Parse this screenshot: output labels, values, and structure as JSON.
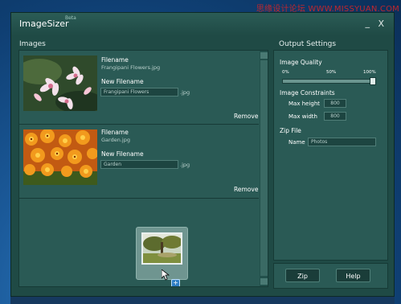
{
  "watermark": "思缘设计论坛 WWW.MISSYUAN.COM",
  "window": {
    "title": "ImageSizer",
    "beta": "Beta",
    "minimize": "_",
    "close": "X"
  },
  "images_panel": {
    "label": "Images",
    "items": [
      {
        "filename_label": "Filename",
        "filename": "Frangipani Flowers.jpg",
        "new_label": "New Filename",
        "new_value": "Frangipani Flowers",
        "ext": ".jpg",
        "remove": "Remove"
      },
      {
        "filename_label": "Filename",
        "filename": "Garden.jpg",
        "new_label": "New Filename",
        "new_value": "Garden",
        "ext": ".jpg",
        "remove": "Remove"
      }
    ],
    "drag_badge": "+"
  },
  "output": {
    "label": "Output Settings",
    "quality": {
      "label": "Image Quality",
      "ticks": [
        "0%",
        "50%",
        "100%"
      ],
      "value_percent": 100
    },
    "constraints": {
      "label": "Image Constraints",
      "max_height_label": "Max height",
      "max_height": "800",
      "max_width_label": "Max width",
      "max_width": "800"
    },
    "zip": {
      "label": "Zip File",
      "name_label": "Name",
      "name_value": "Photos"
    }
  },
  "buttons": {
    "zip": "Zip",
    "help": "Help"
  },
  "colors": {
    "window_bg": "#1f4a45",
    "panel_bg": "#2a5a55",
    "button_bg": "#1a3d39",
    "watermark": "#c0272d"
  }
}
